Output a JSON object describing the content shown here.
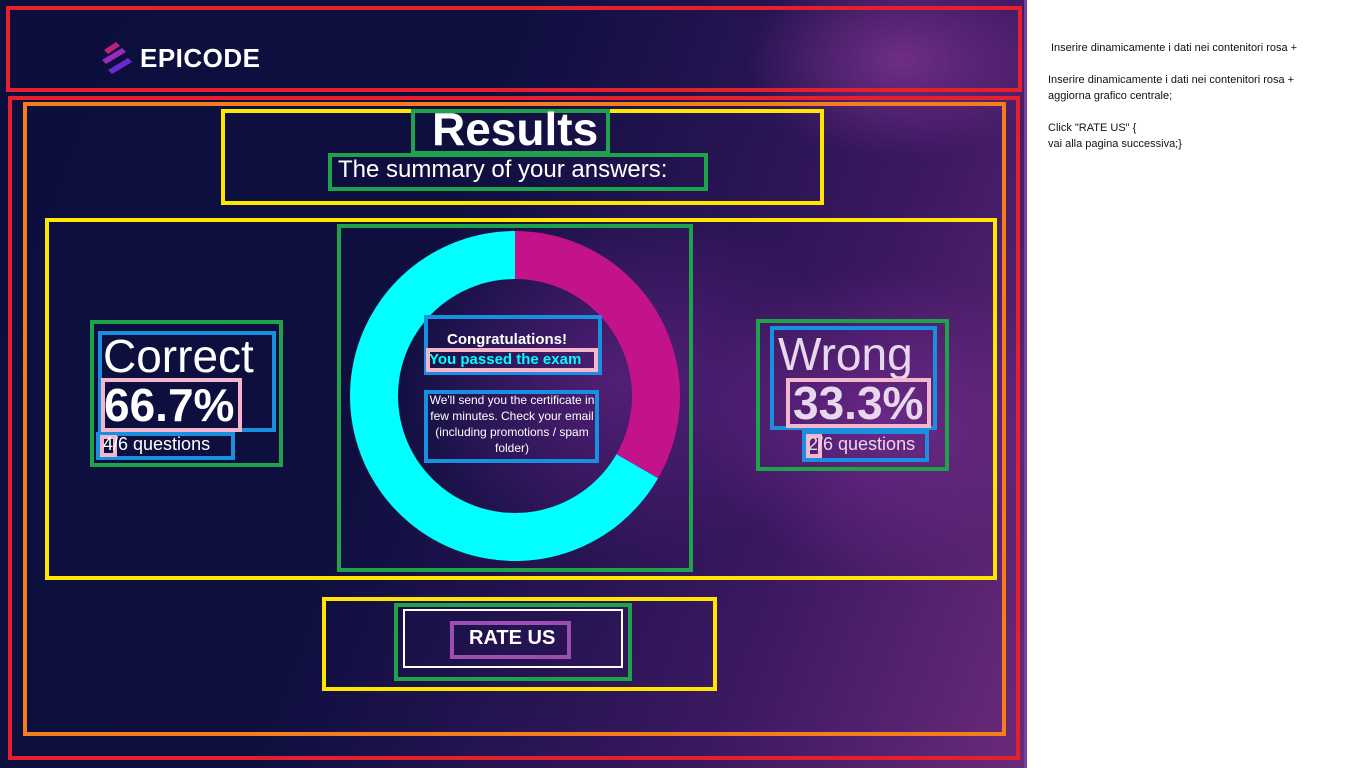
{
  "header": {
    "brand": "EPICODE"
  },
  "results": {
    "title": "Results",
    "subtitle": "The summary of your answers:"
  },
  "correct": {
    "label": "Correct",
    "percent": "66.7%",
    "count": "4",
    "questions_suffix": "/6 questions"
  },
  "wrong": {
    "label": "Wrong",
    "percent": "33.3%",
    "count": "2",
    "questions_suffix": "/6 questions"
  },
  "donut": {
    "congrats": "Congratulations!",
    "passed": "You passed the exam",
    "info": "We'll send you the certificate in few minutes. Check your email (including promotions / spam folder)"
  },
  "chart_data": {
    "type": "pie",
    "categories": [
      "Correct",
      "Wrong"
    ],
    "values": [
      66.7,
      33.3
    ],
    "colors": [
      "#00ffff",
      "#c2138a"
    ]
  },
  "rate_button": {
    "label": "RATE US"
  },
  "notes": {
    "line1": "Inserire dinamicamente i dati nei contenitori rosa +",
    "line2": "Inserire dinamicamente i dati nei contenitori rosa +\naggiorna grafico centrale;",
    "line3": "Click \"RATE US\" {\nvai alla pagina successiva;}"
  },
  "colors": {
    "correct": "#00ffff",
    "wrong": "#c2138a",
    "background": "#0c0f3d"
  }
}
